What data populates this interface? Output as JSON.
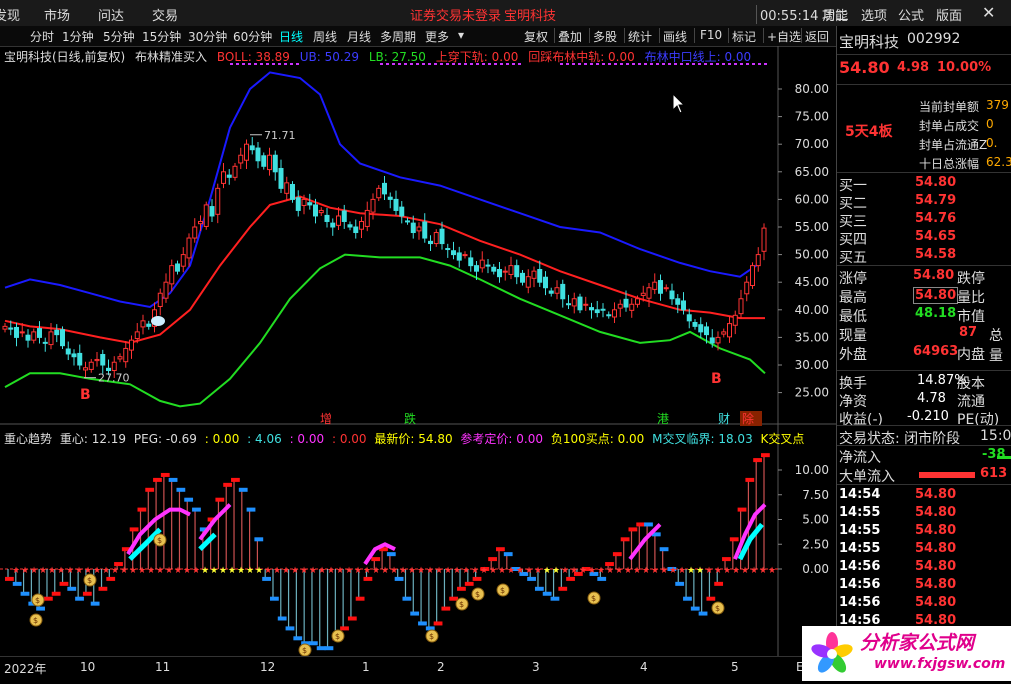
{
  "menubar": {
    "items": [
      "发现",
      "市场",
      "问达",
      "交易"
    ],
    "status": "证券交易未登录",
    "stock": "宝明科技",
    "time": "00:55:14 周二",
    "right": [
      "功能",
      "选项",
      "公式",
      "版面"
    ]
  },
  "toolbar": {
    "left": [
      "分时",
      "1分钟",
      "5分钟",
      "15分钟",
      "30分钟",
      "60分钟",
      "日线",
      "周线",
      "月线",
      "多周期",
      "更多"
    ],
    "active": "日线",
    "right": [
      "复权",
      "叠加",
      "多股",
      "统计",
      "画线",
      "F10",
      "标记",
      "+自选",
      "返回"
    ]
  },
  "main_title": {
    "name": "宝明科技(日线,前复权)",
    "indicator": "布林精准买入",
    "boll": "BOLL: 38.89",
    "ub": "UB: 50.29",
    "lb": "LB: 27.50",
    "up_cross": "上穿下轨: 0.00",
    "back_mid": "回踩布林中轨: 0.00",
    "mid_enter": "布林中口线上: 0.00"
  },
  "price_axis": [
    "80.00",
    "75.00",
    "70.00",
    "65.00",
    "60.00",
    "55.00",
    "50.00",
    "45.00",
    "40.00",
    "35.00",
    "30.00",
    "25.00"
  ],
  "annotations": {
    "high": "71.71",
    "low": "27.70",
    "b1": "B",
    "b2": "B"
  },
  "event_labels": [
    "增",
    "跌",
    "港",
    "财",
    "除"
  ],
  "sub_title": {
    "name": "重心趋势",
    "zx": "重心: 12.19",
    "peg": "PEG: -0.69",
    "v1": ": 0.00",
    "v2": ": 4.06",
    "v3": ": 0.00",
    "v4": ": 0.00",
    "latest": "最新价: 54.80",
    "ref": "参考定价: 0.00",
    "neg": "负100买点: 0.00",
    "mcross": "M交叉临界: 18.03",
    "kcross": "K交叉点"
  },
  "sub_axis": [
    "10.00",
    "7.50",
    "5.00",
    "2.50",
    "0.00"
  ],
  "xaxis": [
    "2022年",
    "10",
    "11",
    "12",
    "1",
    "2",
    "3",
    "4",
    "5",
    "E"
  ],
  "right_panel": {
    "name": "宝明科技",
    "code": "002992",
    "price": "54.80",
    "change": "4.98",
    "pct": "10.00%",
    "board": "5天4板",
    "limit_info": [
      {
        "label": "当前封单额",
        "value": "379"
      },
      {
        "label": "封单占成交",
        "value": "0"
      },
      {
        "label": "封单占流通Z",
        "value": "0."
      },
      {
        "label": "十日总涨幅",
        "value": "62.3"
      }
    ],
    "bids": [
      {
        "label": "买一",
        "price": "54.80"
      },
      {
        "label": "买二",
        "price": "54.79"
      },
      {
        "label": "买三",
        "price": "54.76"
      },
      {
        "label": "买四",
        "price": "54.65"
      },
      {
        "label": "买五",
        "price": "54.58"
      }
    ],
    "stats": [
      {
        "l": "涨停",
        "v": "54.80",
        "r": "跌停"
      },
      {
        "l": "最高",
        "v": "54.80",
        "r": "量比"
      },
      {
        "l": "最低",
        "v": "48.18",
        "r": "市值"
      },
      {
        "l": "现量",
        "v": "87",
        "r": "总量"
      },
      {
        "l": "外盘",
        "v": "64963",
        "r": "内盘"
      }
    ],
    "stats2": [
      {
        "l": "换手",
        "v": "14.87%",
        "r": "股本"
      },
      {
        "l": "净资",
        "v": "4.78",
        "r": "流通"
      },
      {
        "l": "收益(-)",
        "v": "-0.210",
        "r": "PE(动)"
      }
    ],
    "trade_state": "交易状态: 闭市阶段",
    "trade_time": "15:0",
    "net_in": "净流入",
    "net_in_val": "-38",
    "big_in": "大单流入",
    "big_in_val": "613",
    "ticks": [
      {
        "t": "14:54",
        "p": "54.80"
      },
      {
        "t": "14:55",
        "p": "54.80"
      },
      {
        "t": "14:55",
        "p": "54.80"
      },
      {
        "t": "14:55",
        "p": "54.80"
      },
      {
        "t": "14:56",
        "p": "54.80"
      },
      {
        "t": "14:56",
        "p": "54.80"
      },
      {
        "t": "14:56",
        "p": "54.80"
      },
      {
        "t": "14:56",
        "p": "54.80"
      }
    ]
  },
  "logo": {
    "text": "分析家公式网",
    "url": "www.fxjgsw.com"
  },
  "colors": {
    "up": "#ff3333",
    "down": "#40e0e0",
    "ub": "#1a1aff",
    "mid": "#ff2020",
    "lb": "#22dd22",
    "magenta": "#ff33ff",
    "cyan": "#00ffff"
  }
}
